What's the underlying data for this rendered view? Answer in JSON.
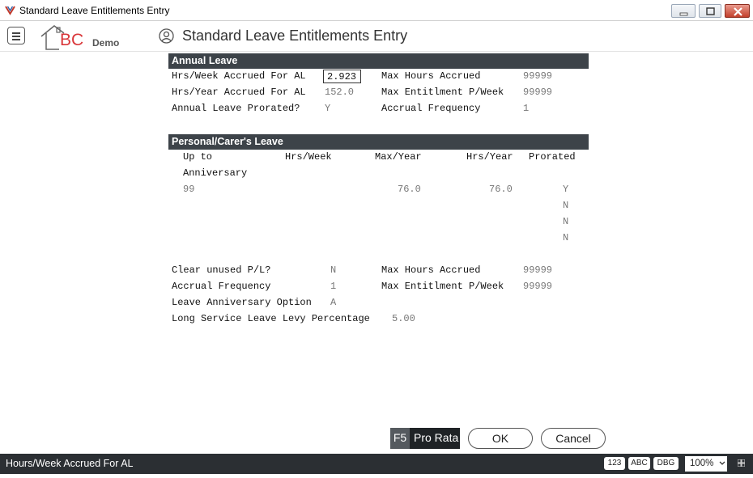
{
  "window": {
    "title": "Standard Leave Entitlements Entry",
    "minimize_icon": "minimize-icon",
    "maximize_icon": "maximize-icon",
    "close_icon": "close-icon"
  },
  "header": {
    "logo_text": "BC",
    "company": "Demo",
    "page_title": "Standard Leave Entitlements Entry"
  },
  "annual_leave": {
    "heading": "Annual Leave",
    "hrs_week_label": "Hrs/Week Accrued For AL",
    "hrs_week_value": "2.923",
    "hrs_year_label": "Hrs/Year Accrued For AL",
    "hrs_year_value": "152.0",
    "prorated_label": "Annual Leave Prorated?",
    "prorated_value": "Y",
    "max_hours_label": "Max Hours Accrued",
    "max_hours_value": "99999",
    "max_ent_label": "Max Entitlment P/Week",
    "max_ent_value": "99999",
    "accrual_freq_label": "Accrual Frequency",
    "accrual_freq_value": "1"
  },
  "personal_leave": {
    "heading": "Personal/Carer's Leave",
    "col_upto": "Up to",
    "col_upto2": "Anniversary",
    "col_hrs_week": "Hrs/Week",
    "col_max_year": "Max/Year",
    "col_hrs_year": "Hrs/Year",
    "col_prorated": "Prorated",
    "rows": [
      {
        "upto": "99",
        "hrs_week": "",
        "max_year": "76.0",
        "hrs_year": "76.0",
        "prorated": "Y"
      },
      {
        "upto": "",
        "hrs_week": "",
        "max_year": "",
        "hrs_year": "",
        "prorated": "N"
      },
      {
        "upto": "",
        "hrs_week": "",
        "max_year": "",
        "hrs_year": "",
        "prorated": "N"
      },
      {
        "upto": "",
        "hrs_week": "",
        "max_year": "",
        "hrs_year": "",
        "prorated": "N"
      }
    ],
    "clear_unused_label": "Clear unused P/L?",
    "clear_unused_value": "N",
    "accrual_freq_label": "Accrual Frequency",
    "accrual_freq_value": "1",
    "anniv_option_label": "Leave Anniversary Option",
    "anniv_option_value": "A",
    "lsl_levy_label": "Long Service Leave Levy Percentage",
    "lsl_levy_value": "5.00",
    "max_hours_label": "Max Hours Accrued",
    "max_hours_value": "99999",
    "max_ent_label": "Max Entitlment P/Week",
    "max_ent_value": "99999"
  },
  "buttons": {
    "prorata_key": "F5",
    "prorata_label": "Pro Rata",
    "ok_label": "OK",
    "cancel_label": "Cancel"
  },
  "status": {
    "message": "Hours/Week Accrued For AL",
    "chip_123": "123",
    "chip_abc": "ABC",
    "chip_dbg": "DBG",
    "zoom": "100%"
  }
}
